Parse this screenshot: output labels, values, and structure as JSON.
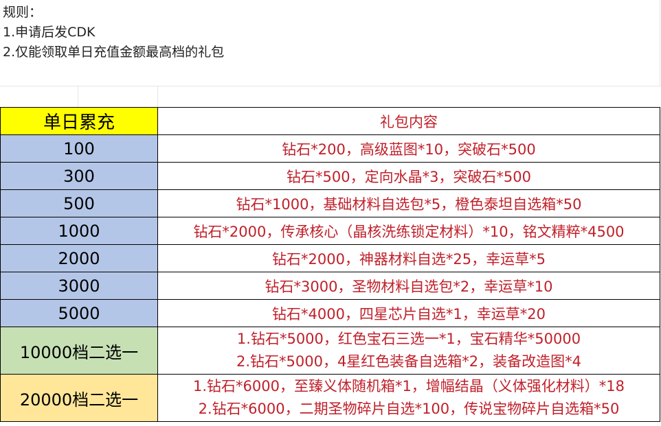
{
  "rules": {
    "title": "规则：",
    "line1": "1.申请后发CDK",
    "line2": "2.仅能领取单日充值金额最高档的礼包"
  },
  "table": {
    "header_amount": "单日累充",
    "header_gift": "礼包内容",
    "rows": [
      {
        "amount": "100",
        "gift": "钻石*200，高级蓝图*10，突破石*500"
      },
      {
        "amount": "300",
        "gift": "钻石*500，定向水晶*3，突破石*500"
      },
      {
        "amount": "500",
        "gift": "钻石*1000，基础材料自选包*5，橙色泰坦自选箱*50"
      },
      {
        "amount": "1000",
        "gift": "钻石*2000，传承核心（晶核洗练锁定材料）*10，铭文精粹*4500"
      },
      {
        "amount": "2000",
        "gift": "钻石*2000，神器材料自选*25，幸运草*5"
      },
      {
        "amount": "3000",
        "gift": "钻石*3000，圣物材料自选包*2，幸运草*10"
      },
      {
        "amount": "5000",
        "gift": "钻石*4000，四星芯片自选*1，幸运草*20"
      }
    ],
    "tier10000": {
      "amount": "10000档二选一",
      "option1": "1.钻石*5000，红色宝石三选一*1，宝石精华*50000",
      "option2": "2.钻石*5000，4星红色装备自选箱*2，装备改造图*4"
    },
    "tier20000": {
      "amount": "20000档二选一",
      "option1": "1.钻石*6000，至臻义体随机箱*1，增幅结晶（义体强化材料）*18",
      "option2": "2.钻石*6000，二期圣物碎片自选*100，传说宝物碎片自选箱*50"
    }
  },
  "colors": {
    "header_amount_bg": "#ffff00",
    "amount_bg": "#b4c6e7",
    "tier10000_bg": "#c6e0b4",
    "tier20000_bg": "#ffe699",
    "gift_text": "#c0202a"
  }
}
